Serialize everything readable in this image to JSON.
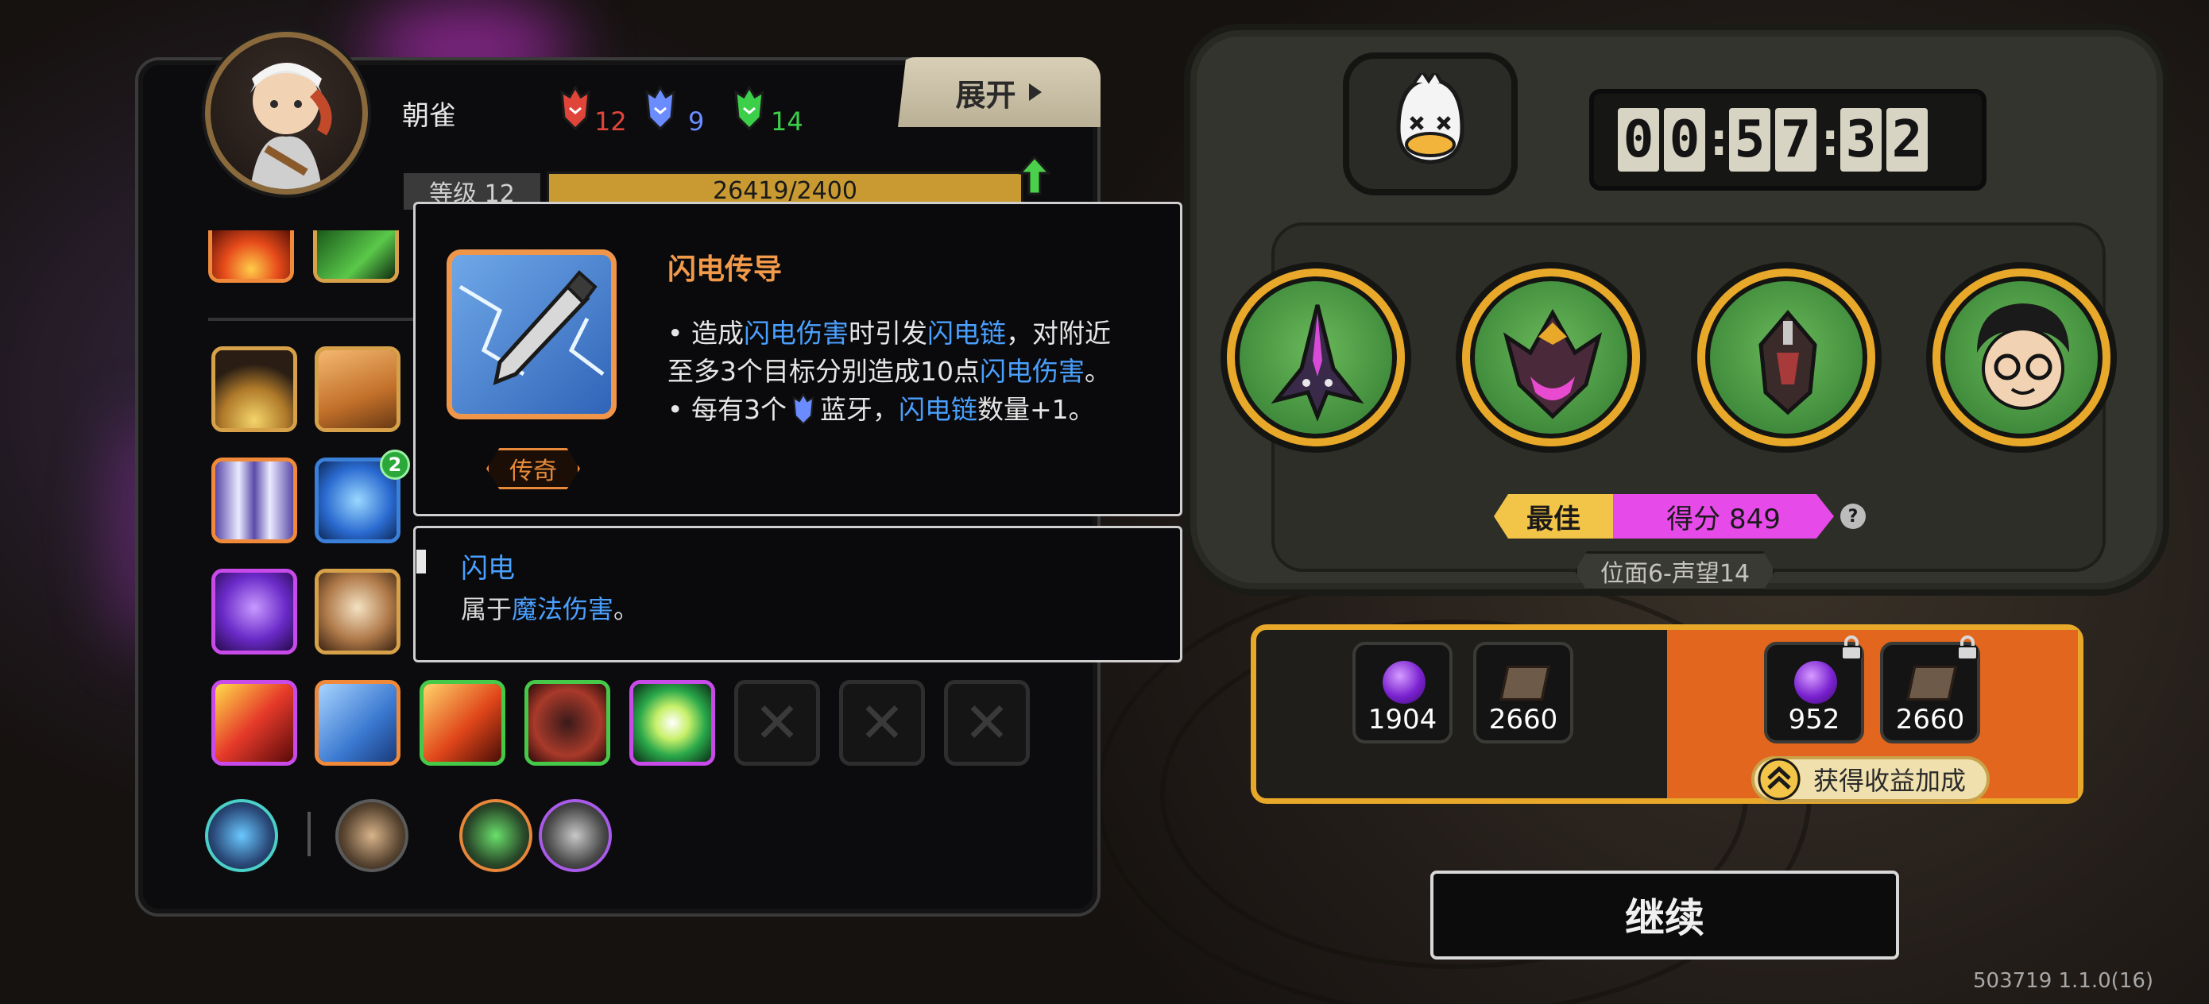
{
  "player": {
    "name": "朝雀",
    "level_label": "等级 12",
    "exp_text": "26419/2400",
    "gems": [
      {
        "color": "red",
        "hex": "#e0453a",
        "count": "12"
      },
      {
        "color": "blue",
        "hex": "#6a8cff",
        "count": "9"
      },
      {
        "color": "green",
        "hex": "#3ccf4a",
        "count": "14"
      }
    ]
  },
  "expand_button": {
    "label": "展开",
    "icon": "triangle-right-icon"
  },
  "skill_slots": {
    "level_badge": "2",
    "empty_slots": 3
  },
  "tooltip": {
    "title": "闪电传导",
    "rarity": "传奇",
    "line1_prefix": "• 造成",
    "line1_hl1": "闪电伤害",
    "line1_mid": "时引发",
    "line1_hl2": "闪电链",
    "line1_suffix": "，对附近",
    "line2_prefix": "至多3个目标分别造成10点",
    "line2_hl": "闪电伤害",
    "line2_suffix": "。",
    "line3_prefix": "• 每有3个",
    "line3_mid": "蓝牙，",
    "line3_hl": "闪电链",
    "line3_suffix": "数量+1。"
  },
  "tag_tooltip": {
    "title": "闪电",
    "desc_prefix": "属于",
    "desc_hl": "魔法伤害",
    "desc_suffix": "。"
  },
  "timer": {
    "digits": [
      "0",
      "0",
      "5",
      "7",
      "3",
      "2"
    ]
  },
  "party_icons": [
    "drake-icon",
    "horned-beast-icon",
    "armored-drake-icon",
    "curly-hair-glasses-icon"
  ],
  "score": {
    "best_label": "最佳",
    "score_text": "得分 849",
    "help": "?"
  },
  "location": "位面6-声望14",
  "rewards": {
    "base": [
      {
        "icon": "purple-orb-icon",
        "value": "1904"
      },
      {
        "icon": "book-icon",
        "value": "2660"
      }
    ],
    "bonus": [
      {
        "icon": "purple-orb-icon",
        "value": "952"
      },
      {
        "icon": "book-icon",
        "value": "2660"
      }
    ],
    "bonus_button": "获得收益加成"
  },
  "continue_label": "继续",
  "version": "503719 1.1.0(16)"
}
